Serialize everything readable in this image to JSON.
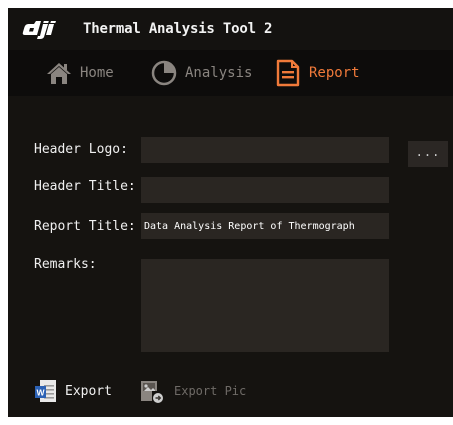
{
  "window": {
    "brand": "dji",
    "title": "Thermal Analysis Tool 2"
  },
  "nav": [
    {
      "label": "Home",
      "icon": "home-icon",
      "active": false
    },
    {
      "label": "Analysis",
      "icon": "pie-chart-icon",
      "active": false
    },
    {
      "label": "Report",
      "icon": "document-icon",
      "active": true
    }
  ],
  "form": {
    "header_logo": {
      "label": "Header Logo:",
      "value": ""
    },
    "browse_label": "...",
    "header_title": {
      "label": "Header Title:",
      "value": ""
    },
    "report_title": {
      "label": "Report Title:",
      "value": "Data Analysis Report of Thermograph"
    },
    "remarks": {
      "label": "Remarks:",
      "value": ""
    }
  },
  "actions": {
    "export_label": "Export",
    "export_pic_label": "Export Pic"
  },
  "colors": {
    "accent": "#f07a3a",
    "background": "#151310",
    "field": "#2a2622",
    "muted": "#8a8580"
  }
}
